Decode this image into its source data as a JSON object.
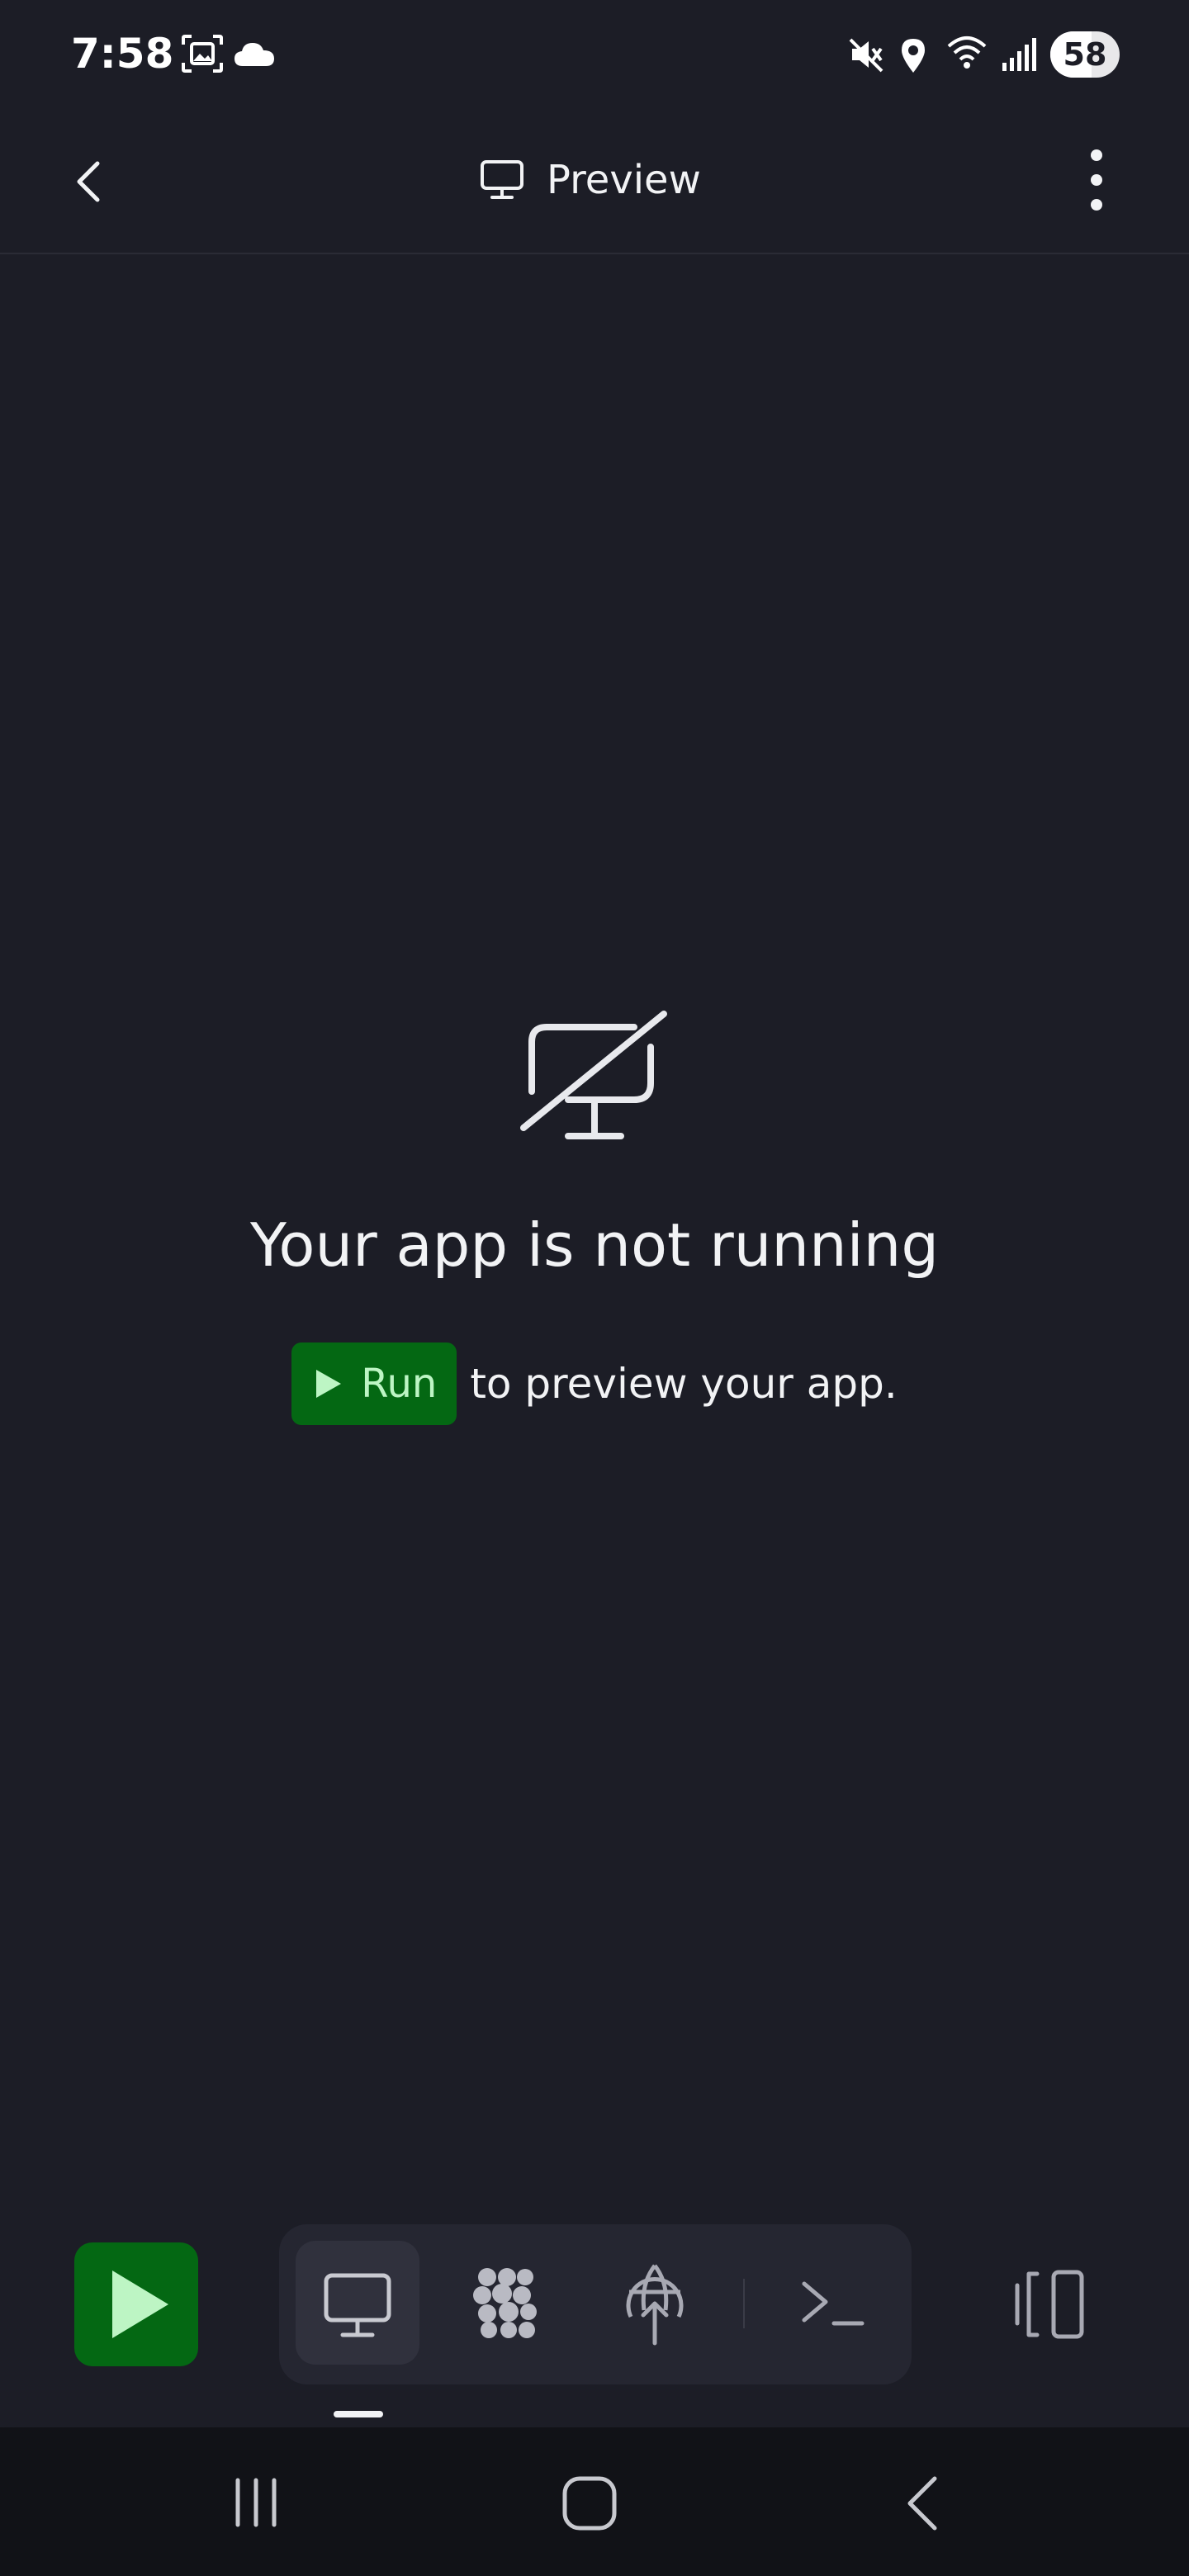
{
  "status_bar": {
    "time": "7:58",
    "battery_level": "58",
    "icons": [
      "screenshot-icon",
      "cloud-icon",
      "mute-icon",
      "location-icon",
      "wifi-icon",
      "signal-icon",
      "battery-icon"
    ]
  },
  "header": {
    "title": "Preview",
    "title_icon": "monitor-icon",
    "back_icon": "chevron-left-icon",
    "more_icon": "more-vertical-icon"
  },
  "empty_state": {
    "icon": "monitor-off-icon",
    "title": "Your app is not running",
    "run_chip_label": "Run",
    "run_suffix": "to preview your app."
  },
  "toolbar": {
    "run_icon": "play-icon",
    "tools": [
      {
        "name": "preview",
        "icon": "monitor-icon",
        "active": true
      },
      {
        "name": "agent",
        "icon": "dots-grid-icon",
        "active": false
      },
      {
        "name": "deploy",
        "icon": "globe-upload-icon",
        "active": false
      },
      {
        "name": "shell",
        "icon": "terminal-icon",
        "active": false
      }
    ],
    "layout_icon": "layout-panels-icon"
  },
  "system_nav": {
    "icons": [
      "recent-apps-icon",
      "home-icon",
      "back-icon"
    ]
  },
  "colors": {
    "background": "#1c1d26",
    "run_green": "#046813",
    "run_text": "#bdf5c4",
    "toolbar_bg": "#252631",
    "nav_bg": "#111217"
  }
}
